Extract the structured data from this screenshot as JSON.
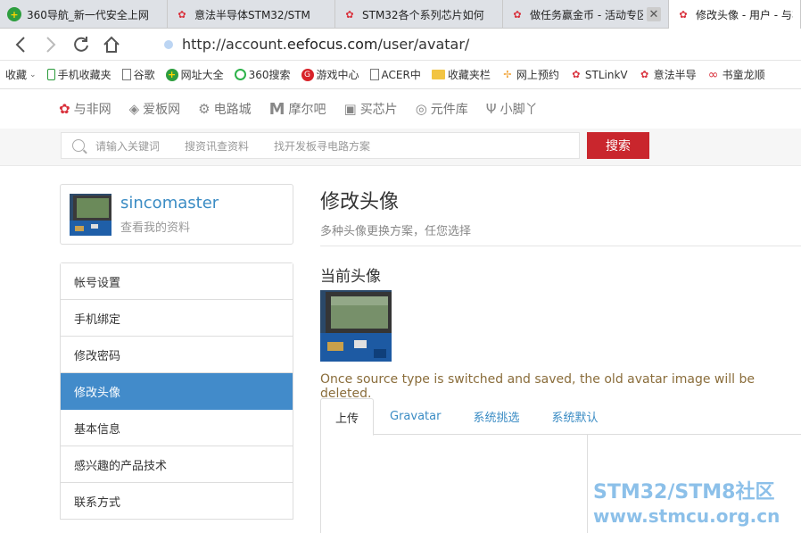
{
  "browser": {
    "tabs": [
      {
        "title": "360导航_新一代安全上网",
        "icon": "globe-360-icon",
        "active": false
      },
      {
        "title": "意法半导体STM32/STM",
        "icon": "st-logo-icon",
        "active": false
      },
      {
        "title": "STM32各个系列芯片如何",
        "icon": "st-logo-icon",
        "active": false
      },
      {
        "title": "做任务赢金币 - 活动专区",
        "icon": "st-logo-icon",
        "active": false
      },
      {
        "title": "修改头像 - 用户 - 与非网",
        "icon": "st-logo-icon",
        "active": true
      }
    ],
    "url_prefix": "http://account.",
    "url_host": "eefocus.com",
    "url_path": "/user/avatar/",
    "close_glyph": "✕"
  },
  "bookmarks": [
    {
      "label": "收藏",
      "icon": "star-icon"
    },
    {
      "label": "手机收藏夹",
      "icon": "phone-icon"
    },
    {
      "label": "谷歌",
      "icon": "page-icon"
    },
    {
      "label": "网址大全",
      "icon": "globe-360-icon"
    },
    {
      "label": "360搜索",
      "icon": "search-360-icon"
    },
    {
      "label": "游戏中心",
      "icon": "game-icon"
    },
    {
      "label": "ACER中",
      "icon": "page-icon"
    },
    {
      "label": "收藏夹栏",
      "icon": "folder-icon"
    },
    {
      "label": "网上预约",
      "icon": "pinwheel-icon"
    },
    {
      "label": "STLinkV",
      "icon": "st-logo-icon"
    },
    {
      "label": "意法半导",
      "icon": "st-logo-icon"
    },
    {
      "label": "书童龙顺",
      "icon": "infinity-icon"
    }
  ],
  "site_nav": [
    {
      "label": "与非网",
      "icon": "eefocus-icon"
    },
    {
      "label": "爱板网",
      "icon": "diamond-icon"
    },
    {
      "label": "电路城",
      "icon": "gear-icon"
    },
    {
      "label": "摩尔吧",
      "icon": "m-logo-icon"
    },
    {
      "label": "买芯片",
      "icon": "chip-icon"
    },
    {
      "label": "元件库",
      "icon": "swirl-icon"
    },
    {
      "label": "小脚丫",
      "icon": "foot-icon"
    }
  ],
  "search": {
    "hints": [
      "请输入关键词",
      "搜资讯查资料",
      "找开发板寻电路方案"
    ],
    "button": "搜索"
  },
  "profile": {
    "username": "sincomaster",
    "view_link": "查看我的资料"
  },
  "menu": [
    {
      "label": "帐号设置",
      "active": false
    },
    {
      "label": "手机绑定",
      "active": false
    },
    {
      "label": "修改密码",
      "active": false
    },
    {
      "label": "修改头像",
      "active": true
    },
    {
      "label": "基本信息",
      "active": false
    },
    {
      "label": "感兴趣的产品技术",
      "active": false
    },
    {
      "label": "联系方式",
      "active": false
    }
  ],
  "main": {
    "title": "修改头像",
    "subtitle": "多种头像更换方案，任您选择",
    "current_title": "当前头像",
    "note": "Once source type is switched and saved, the old avatar image will be deleted.",
    "tabs": [
      {
        "label": "上传",
        "active": true
      },
      {
        "label": "Gravatar",
        "active": false
      },
      {
        "label": "系统挑选",
        "active": false
      },
      {
        "label": "系统默认",
        "active": false
      }
    ]
  },
  "watermark": {
    "line1": "STM32/STM8社区",
    "line2": "www.stmcu.org.cn"
  },
  "colors": {
    "accent": "#428bca",
    "link": "#3b8cc4",
    "search_button": "#c9262d",
    "note_text": "#8a6d3b"
  }
}
